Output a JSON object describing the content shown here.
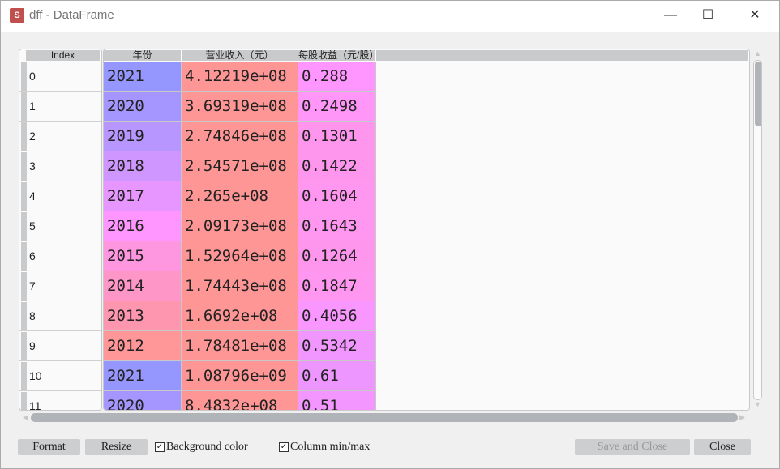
{
  "window": {
    "title": "dff - DataFrame",
    "icon": "spyder-icon",
    "controls": [
      "minimize",
      "maximize",
      "close"
    ]
  },
  "table": {
    "index_header": "Index",
    "columns": [
      "年份",
      "营业收入（元）",
      "每股收益（元/股）"
    ],
    "rows": [
      {
        "index": "0",
        "values": [
          "2021",
          "4.12219e+08",
          "0.288"
        ],
        "colors": [
          "#9696ff",
          "#ff9696",
          "#ff96ff"
        ]
      },
      {
        "index": "1",
        "values": [
          "2020",
          "3.69319e+08",
          "0.2498"
        ],
        "colors": [
          "#a596ff",
          "#ff9696",
          "#ff96f8"
        ]
      },
      {
        "index": "2",
        "values": [
          "2019",
          "2.74846e+08",
          "0.1301"
        ],
        "colors": [
          "#b896ff",
          "#ff9696",
          "#ff96ee"
        ]
      },
      {
        "index": "3",
        "values": [
          "2018",
          "2.54571e+08",
          "0.1422"
        ],
        "colors": [
          "#d096ff",
          "#ff9696",
          "#ff96ee"
        ]
      },
      {
        "index": "4",
        "values": [
          "2017",
          "2.265e+08",
          "0.1604"
        ],
        "colors": [
          "#e896ff",
          "#ff9696",
          "#ff96ef"
        ]
      },
      {
        "index": "5",
        "values": [
          "2016",
          "2.09173e+08",
          "0.1643"
        ],
        "colors": [
          "#ff96ff",
          "#ff9696",
          "#ff96ef"
        ]
      },
      {
        "index": "6",
        "values": [
          "2015",
          "1.52964e+08",
          "0.1264"
        ],
        "colors": [
          "#ff96e0",
          "#ff9696",
          "#ff96ee"
        ]
      },
      {
        "index": "7",
        "values": [
          "2014",
          "1.74443e+08",
          "0.1847"
        ],
        "colors": [
          "#ff96c8",
          "#ff9696",
          "#ff96f0"
        ]
      },
      {
        "index": "8",
        "values": [
          "2013",
          "1.6692e+08",
          "0.4056"
        ],
        "colors": [
          "#ff96b0",
          "#ff9696",
          "#fa96ff"
        ]
      },
      {
        "index": "9",
        "values": [
          "2012",
          "1.78481e+08",
          "0.5342"
        ],
        "colors": [
          "#ff9698",
          "#ff9696",
          "#f296ff"
        ]
      },
      {
        "index": "10",
        "values": [
          "2021",
          "1.08796e+09",
          "0.61"
        ],
        "colors": [
          "#9696ff",
          "#ff9696",
          "#ee96ff"
        ]
      },
      {
        "index": "11",
        "values": [
          "2020",
          "8.4832e+08",
          "0.51"
        ],
        "colors": [
          "#a596ff",
          "#ff9696",
          "#f496ff"
        ]
      }
    ]
  },
  "buttons": {
    "format": "Format",
    "resize": "Resize",
    "save_close": "Save and Close",
    "close": "Close"
  },
  "checkboxes": [
    {
      "label": "Background color",
      "checked": true
    },
    {
      "label": "Column min/max",
      "checked": true
    }
  ]
}
